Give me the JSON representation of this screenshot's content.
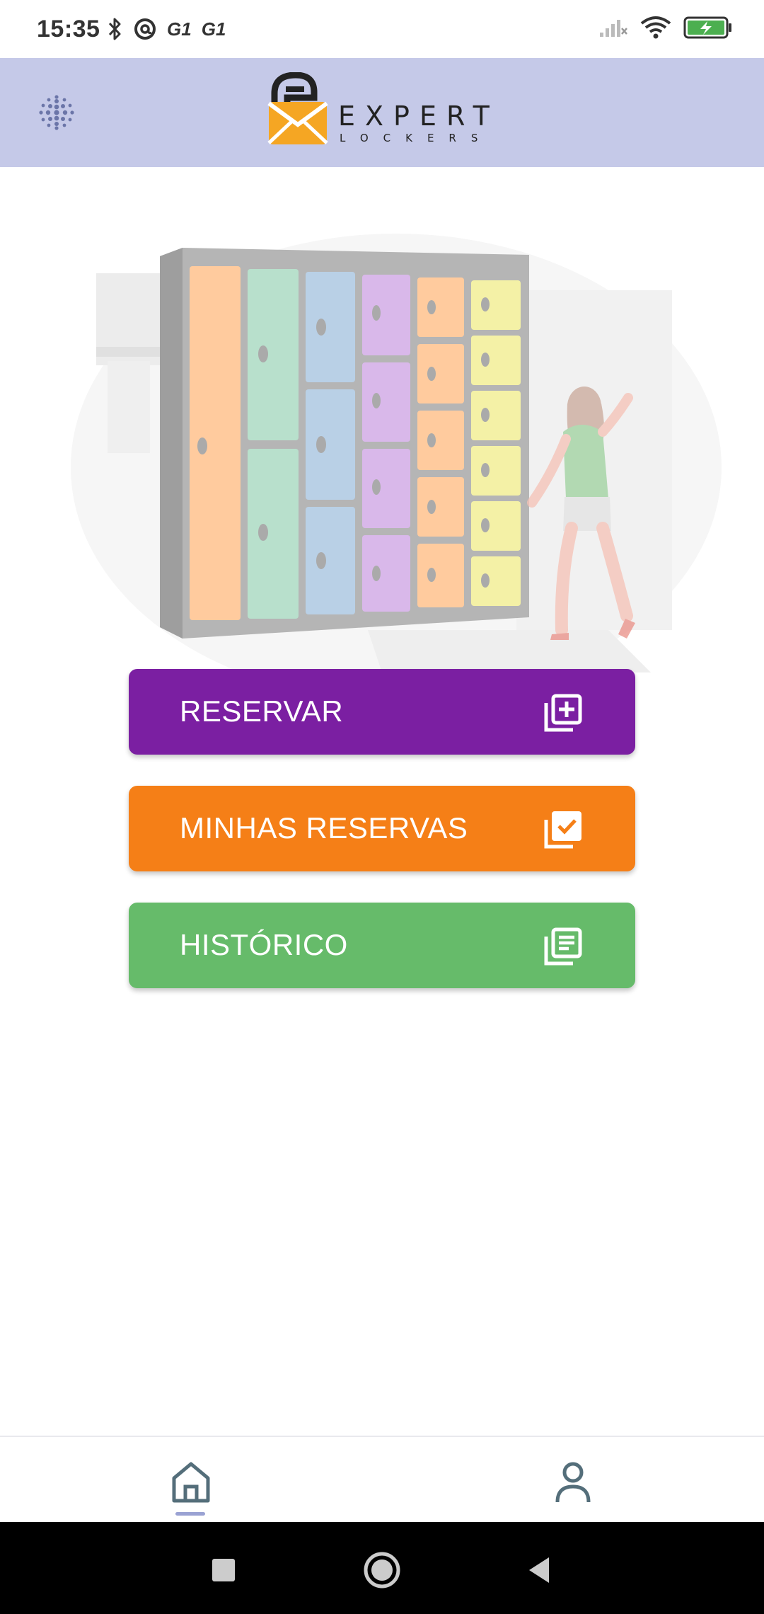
{
  "status_bar": {
    "time": "15:35",
    "carrier_1": "G1",
    "carrier_2": "G1",
    "icons": [
      "bluetooth-icon",
      "vpn-icon",
      "signal-icon",
      "wifi-icon",
      "battery-charging-icon"
    ]
  },
  "header": {
    "logo_word_1": "EXPERT",
    "logo_word_2": "LOCKERS",
    "menu_icon": "dots-grid-icon"
  },
  "actions": [
    {
      "label": "RESERVAR",
      "icon": "add-library-icon",
      "color": "#7b1fa2"
    },
    {
      "label": "MINHAS RESERVAS",
      "icon": "check-library-icon",
      "color": "#f57f17"
    },
    {
      "label": "HISTÓRICO",
      "icon": "list-library-icon",
      "color": "#66bb6a"
    }
  ],
  "bottom_nav": {
    "items": [
      {
        "icon": "home-icon",
        "active": true
      },
      {
        "icon": "person-icon",
        "active": false
      }
    ],
    "accent": "#9aa2d3"
  },
  "colors": {
    "header_bg": "#c5c9e8",
    "purple": "#7b1fa2",
    "orange": "#f57f17",
    "green": "#66bb6a"
  }
}
